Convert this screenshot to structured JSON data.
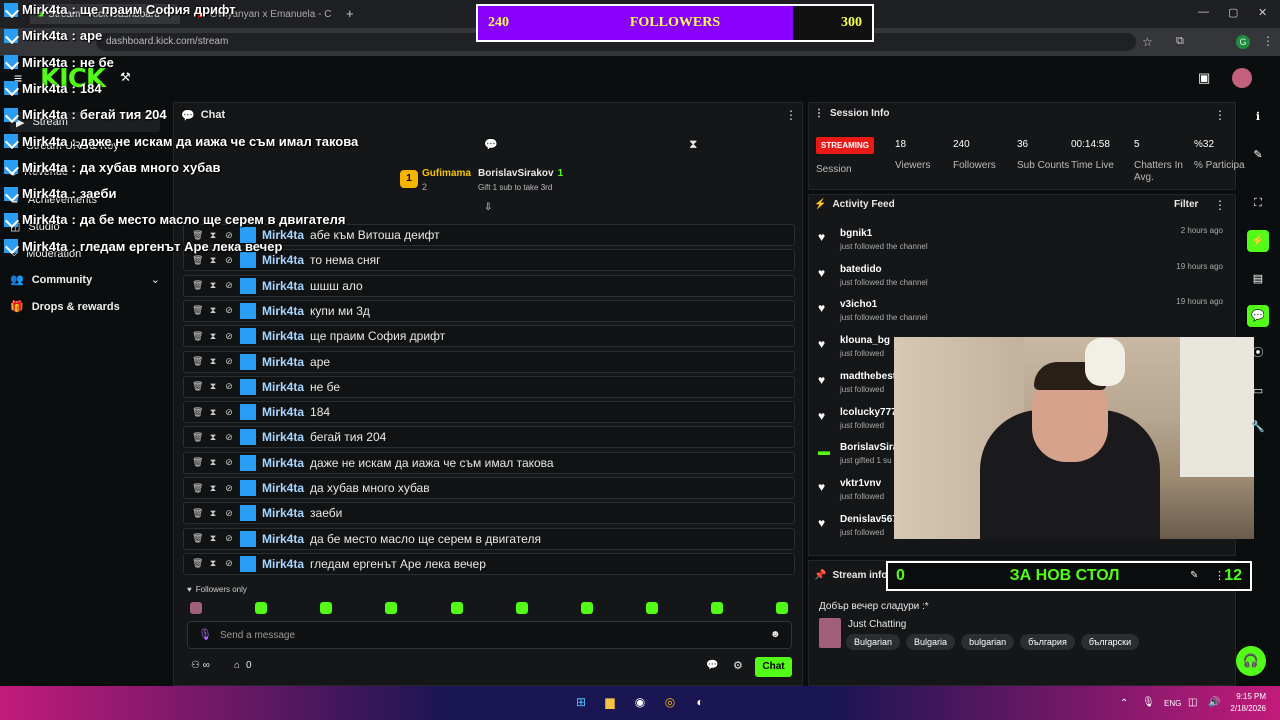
{
  "browser": {
    "tabs": [
      {
        "label": "Stream - Kick Dashboard"
      },
      {
        "label": "Ovsyanyan x Emanuela - C"
      }
    ],
    "url": "dashboard.kick.com/stream"
  },
  "followers_goal": {
    "start": "240",
    "label": "FOLLOWERS",
    "end": "300",
    "progress": 0.8
  },
  "header": {
    "logo": "KICK"
  },
  "nav": [
    {
      "label": "Stream"
    },
    {
      "label": "Stream URL & Key"
    },
    {
      "label": "Revenue"
    },
    {
      "label": "Achievements"
    },
    {
      "label": "Studio"
    },
    {
      "label": "Moderation"
    },
    {
      "label": "Community"
    },
    {
      "label": "Drops & rewards"
    }
  ],
  "overlay_chat": [
    {
      "user": "Mirk4ta",
      "text": "ще праим София дрифт"
    },
    {
      "user": "Mirk4ta",
      "text": "аре"
    },
    {
      "user": "Mirk4ta",
      "text": "не бе"
    },
    {
      "user": "Mirk4ta",
      "text": "184"
    },
    {
      "user": "Mirk4ta",
      "text": "бегай тия 204"
    },
    {
      "user": "Mirk4ta",
      "text": "даже не искам да иажа че съм имал такова"
    },
    {
      "user": "Mirk4ta",
      "text": "да хубав много хубав"
    },
    {
      "user": "Mirk4ta",
      "text": "заеби"
    },
    {
      "user": "Mirk4ta",
      "text": "да бе место масло ще серем в двигателя"
    },
    {
      "user": "Mirk4ta",
      "text": "гледам ергенът Аре лека вечер"
    }
  ],
  "chat": {
    "title": "Chat",
    "leader1": {
      "rank": "1",
      "name": "Gufimama",
      "count": "2"
    },
    "leader2": {
      "name": "BorislavSirakov",
      "count": "1",
      "note": "Gift 1 sub to take 3rd"
    },
    "messages": [
      {
        "user": "Mirk4ta",
        "text": "абе към Витоша деифт"
      },
      {
        "user": "Mirk4ta",
        "text": "то нема сняг"
      },
      {
        "user": "Mirk4ta",
        "text": "шшш ало"
      },
      {
        "user": "Mirk4ta",
        "text": "купи ми 3д"
      },
      {
        "user": "Mirk4ta",
        "text": "ще праим София дрифт"
      },
      {
        "user": "Mirk4ta",
        "text": "аре"
      },
      {
        "user": "Mirk4ta",
        "text": "не бе"
      },
      {
        "user": "Mirk4ta",
        "text": "184"
      },
      {
        "user": "Mirk4ta",
        "text": "бегай тия 204"
      },
      {
        "user": "Mirk4ta",
        "text": "даже не искам да иажа че съм имал такова"
      },
      {
        "user": "Mirk4ta",
        "text": "да хубав много хубав"
      },
      {
        "user": "Mirk4ta",
        "text": "заеби"
      },
      {
        "user": "Mirk4ta",
        "text": "да бе место масло ще серем в двигателя"
      },
      {
        "user": "Mirk4ta",
        "text": "гледам ергенът Аре лека вечер"
      }
    ],
    "followers_only": "Followers only",
    "input_placeholder": "Send a message",
    "points_value": "0",
    "send_label": "Chat"
  },
  "session": {
    "title": "Session Info",
    "status": "STREAMING",
    "status_label": "Session",
    "stats": [
      {
        "value": "18",
        "label": "Viewers"
      },
      {
        "value": "240",
        "label": "Followers"
      },
      {
        "value": "36",
        "label": "Sub Counts"
      },
      {
        "value": "00:14:58",
        "label": "Time Live"
      },
      {
        "value": "5",
        "label": "Chatters In Avg."
      },
      {
        "value": "%32",
        "label": "% Participa"
      }
    ]
  },
  "activity": {
    "title": "Activity Feed",
    "filter": "Filter",
    "items": [
      {
        "name": "bgnik1",
        "action": "just followed the channel",
        "time": "2 hours ago"
      },
      {
        "name": "batedido",
        "action": "just followed the channel",
        "time": "19 hours ago"
      },
      {
        "name": "v3icho1",
        "action": "just followed the channel",
        "time": "19 hours ago"
      },
      {
        "name": "klouna_bg",
        "action": "just followed",
        "time": ""
      },
      {
        "name": "madthebest",
        "action": "just followed",
        "time": ""
      },
      {
        "name": "lcolucky777",
        "action": "just followed",
        "time": ""
      },
      {
        "name": "BorislavSira",
        "action": "just gifted 1 su",
        "time": ""
      },
      {
        "name": "vktr1vnv",
        "action": "just followed",
        "time": ""
      },
      {
        "name": "Denislav567",
        "action": "just followed",
        "time": ""
      }
    ]
  },
  "stream_info": {
    "title": "Stream info",
    "goal_start": "0",
    "goal_label": "ЗА НОВ СТОЛ",
    "goal_end": "12",
    "stream_title": "Добър вечер сладури :*",
    "category": "Just Chatting",
    "tags": [
      "Bulgarian",
      "Bulgaria",
      "bulgarian",
      "българия",
      "български"
    ]
  },
  "taskbar": {
    "lang": "ENG",
    "time": "9:15 PM",
    "date": "2/18/2026"
  },
  "colors": {
    "accent": "#53fc18",
    "goal_fill": "#8a00ff",
    "goal_text": "#f7ff4f",
    "streaming": "#e91916"
  }
}
